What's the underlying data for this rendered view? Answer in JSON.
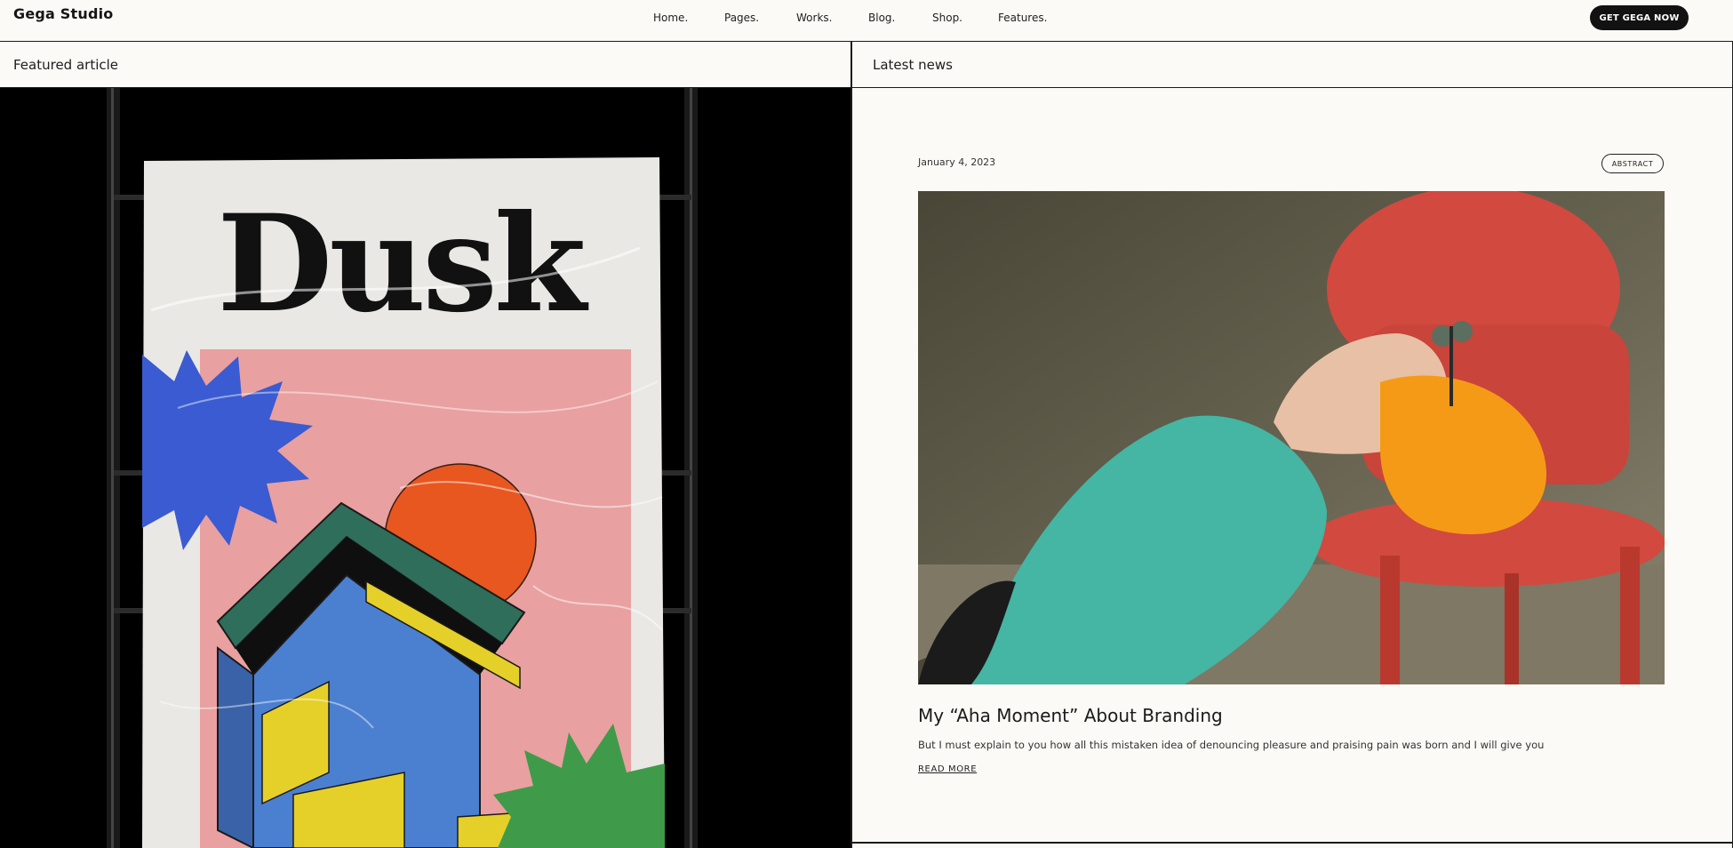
{
  "header": {
    "logo": "Gega Studio",
    "nav": [
      {
        "label": "Home."
      },
      {
        "label": "Pages."
      },
      {
        "label": "Works."
      },
      {
        "label": "Blog."
      },
      {
        "label": "Shop."
      },
      {
        "label": "Features."
      }
    ],
    "cta_label": "GET GEGA NOW"
  },
  "featured": {
    "heading": "Featured article",
    "poster_word": "Dusk"
  },
  "latest": {
    "heading": "Latest news",
    "article": {
      "date": "January 4, 2023",
      "tag": "ABSTRACT",
      "title": "My “Aha Moment” About Branding",
      "excerpt": "But I must explain to you how all this mistaken idea of denouncing pleasure and praising pain was born and I will give you",
      "read_more": "READ MORE"
    }
  },
  "colors": {
    "background": "#fbfaf6",
    "ink": "#121212",
    "poster_pink": "#e9a0a0",
    "poster_blue": "#3a5bd1",
    "poster_orange": "#e8571f",
    "poster_green": "#3f9b4a",
    "poster_yellow": "#e5d02a",
    "chair_red": "#d2493f",
    "shirt_teal": "#45b5a4",
    "hair_orange": "#f59a17"
  }
}
